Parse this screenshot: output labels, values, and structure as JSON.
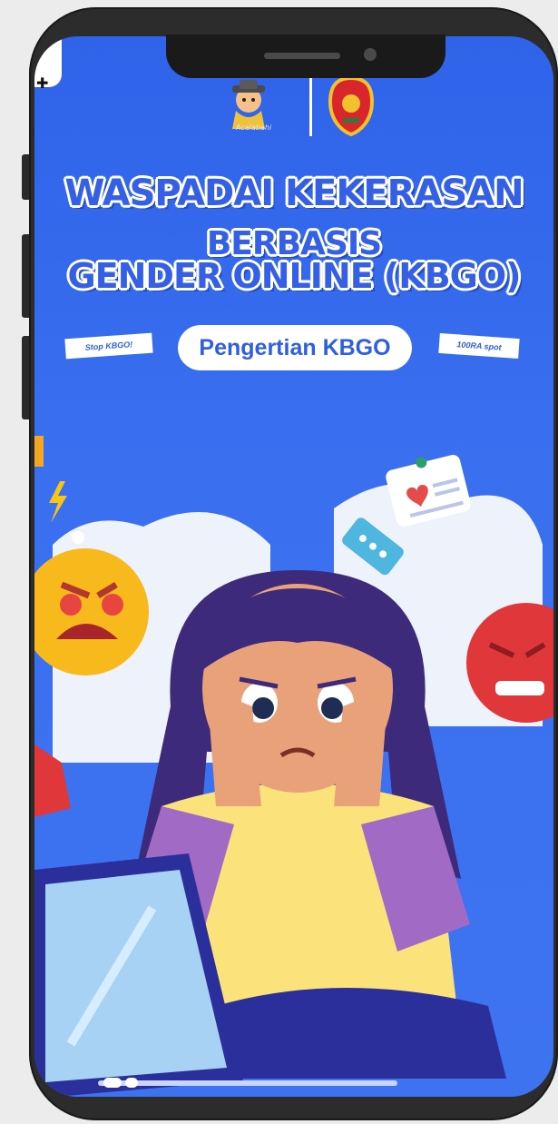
{
  "headline": {
    "line1": "WASPADAI KEKERASAN",
    "line2": "BERBASIS",
    "line3": "GENDER ONLINE (KBGO)"
  },
  "subtitle_pill": "Pengertian KBGO",
  "ribbon_left": "Stop KBGO!",
  "ribbon_right": "100RA spot",
  "logo_text": "Acalabahi",
  "colors": {
    "background": "#3a6ff0",
    "headline": "#3560e6",
    "phone_frame": "#2c2c2c"
  },
  "icons": [
    "angry-emoji-icon",
    "furious-emoji-icon",
    "heart-note-icon",
    "chat-bubble-icon",
    "lightning-icon"
  ]
}
